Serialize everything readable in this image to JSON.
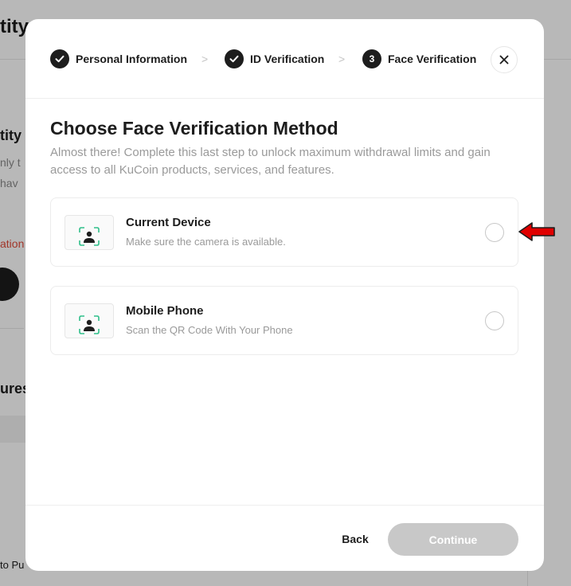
{
  "background": {
    "title": "tity",
    "section_title": "tity",
    "line1": "nly t",
    "line2": " hav",
    "status": "ation",
    "features": "ures",
    "footer_text": "to Pu"
  },
  "steps": [
    {
      "label": "Personal Information",
      "state": "done"
    },
    {
      "label": "ID Verification",
      "state": "done"
    },
    {
      "label": "Face Verification",
      "state": "current",
      "number": "3"
    }
  ],
  "separator": ">",
  "modal": {
    "title": "Choose Face Verification Method",
    "description": "Almost there! Complete this last step to unlock maximum withdrawal limits and gain access to all KuCoin products, services, and features.",
    "options": [
      {
        "title": "Current Device",
        "subtitle": "Make sure the camera is available.",
        "icon": "face-scan-icon",
        "selected": false
      },
      {
        "title": "Mobile Phone",
        "subtitle": "Scan the QR Code With Your Phone",
        "icon": "face-scan-icon",
        "selected": false
      }
    ],
    "back_label": "Back",
    "continue_label": "Continue"
  },
  "colors": {
    "accent": "#1d1d1d",
    "face_green": "#2fbf8a",
    "disabled_button": "#c8c8c8",
    "arrow_red": "#e00000"
  }
}
